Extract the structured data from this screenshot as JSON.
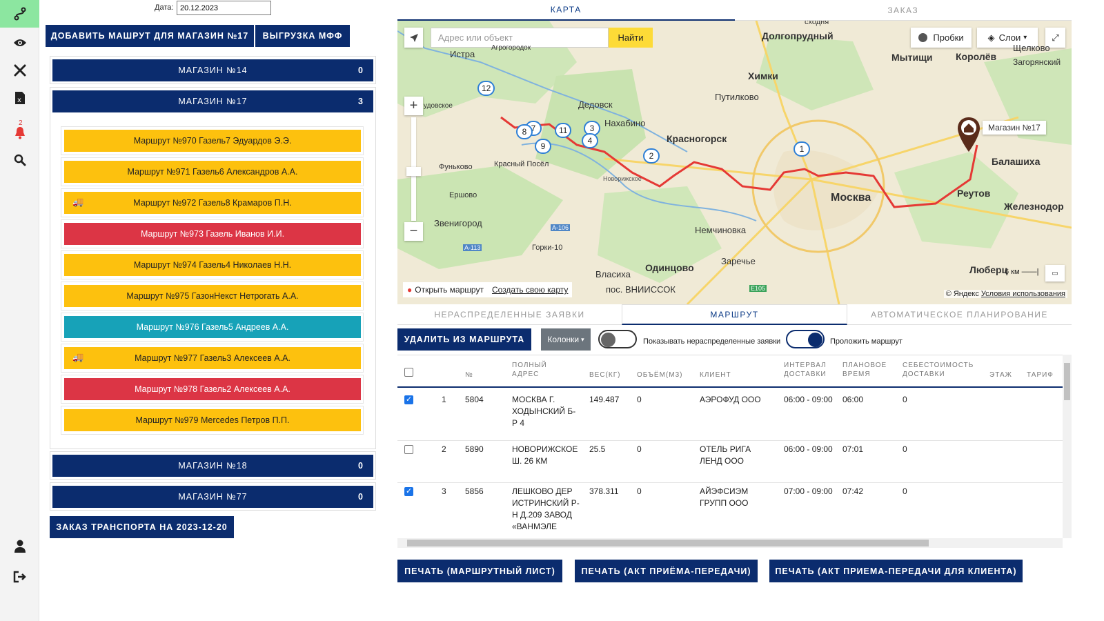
{
  "sidebar": {
    "items": [
      {
        "icon": "route-icon"
      },
      {
        "icon": "eye-icon"
      },
      {
        "icon": "tools-icon"
      },
      {
        "icon": "excel-file-icon"
      },
      {
        "icon": "bell-icon",
        "badge": "2"
      },
      {
        "icon": "search-icon"
      },
      {
        "icon": "user-icon"
      },
      {
        "icon": "logout-icon"
      }
    ]
  },
  "header": {
    "date_label": "Дата:",
    "date_value": "20.12.2023",
    "add_route_label": "ДОБАВИТЬ МАШРУТ ДЛЯ МАГАЗИН №17",
    "export_label": "ВЫГРУЗКА МФФ"
  },
  "stores": [
    {
      "name": "МАГАЗИН №14",
      "count": "0"
    },
    {
      "name": "МАГАЗИН №17",
      "count": "3"
    },
    {
      "name": "МАГАЗИН №18",
      "count": "0"
    },
    {
      "name": "МАГАЗИН №77",
      "count": "0"
    }
  ],
  "routes": [
    {
      "label": "Маршрут №970 Газель7 Эдуардов Э.Э.",
      "color": "yellow",
      "truck": false
    },
    {
      "label": "Маршрут №971 Газель6 Александров А.А.",
      "color": "yellow",
      "truck": false
    },
    {
      "label": "Маршрут №972 Газель8 Крамаров П.Н.",
      "color": "yellow",
      "truck": true
    },
    {
      "label": "Маршрут №973 Газель Иванов И.И.",
      "color": "red",
      "truck": false
    },
    {
      "label": "Маршрут №974 Газель4 Николаев Н.Н.",
      "color": "yellow",
      "truck": false
    },
    {
      "label": "Маршрут №975 ГазонНекст Нетрогать А.А.",
      "color": "yellow",
      "truck": false
    },
    {
      "label": "Маршрут №976 Газель5 Андреев А.А.",
      "color": "teal",
      "truck": false
    },
    {
      "label": "Маршрут №977 Газель3 Алексеев А.А.",
      "color": "yellow",
      "truck": true
    },
    {
      "label": "Маршрут №978 Газель2 Алексеев А.А.",
      "color": "red",
      "truck": false
    },
    {
      "label": "Маршрут №979 Mercedes Петров П.П.",
      "color": "yellow",
      "truck": false
    }
  ],
  "transport_order_label": "ЗАКАЗ ТРАНСПОРТА НА 2023-12-20",
  "top_tabs": [
    {
      "label": "КАРТА",
      "active": true
    },
    {
      "label": "ЗАКАЗ",
      "active": false
    }
  ],
  "map": {
    "search_placeholder": "Адрес или объект",
    "find_label": "Найти",
    "traffic_label": "Пробки",
    "layers_label": "Слои",
    "open_route_label": "Открыть маршрут",
    "create_map_label": "Создать свою карту",
    "copyright": "© Яндекс",
    "terms": "Условия использования",
    "scale": "6 км",
    "store_marker": "Магазин №17",
    "labels": {
      "dolgoprudny": "Долгопрудный",
      "mytishchi": "Мытищи",
      "korolev": "Королёв",
      "shchelkovo": "Щелково",
      "zagoryansky": "Загорянский",
      "istra": "Истра",
      "khimki": "Химки",
      "putilkovo": "Путилково",
      "dedovsk": "Дедовск",
      "nakhabino": "Нахабино",
      "krasnogorsk": "Красногорск",
      "balashikha": "Балашиха",
      "moskva": "Москва",
      "reutov": "Реутов",
      "zheleznodor": "Железнодор",
      "funkovo": "Фуньково",
      "ershovo": "Ершово",
      "zvenigorod": "Звенигород",
      "krasny": "Красный Посёл",
      "nemchinovka": "Немчиновка",
      "zarechye": "Заречье",
      "gorki": "Горки-10",
      "vlasikha": "Власиха",
      "odintsovo": "Одинцово",
      "vniissok": "пос. ВНИИССОК",
      "lyuber": "Люберц",
      "a106": "А-106",
      "a113": "А-113",
      "e105": "E105",
      "ssh": "сходня",
      "agrogorodok": "Агрогородок",
      "udoskoe": "удовское",
      "novaya": "Новорижское"
    },
    "pins": [
      "1",
      "2",
      "3",
      "4",
      "7",
      "8",
      "9",
      "11",
      "12"
    ]
  },
  "mid_tabs": [
    {
      "label": "НЕРАСПРЕДЕЛЕННЫЕ ЗАЯВКИ",
      "active": false
    },
    {
      "label": "МАРШРУТ",
      "active": true
    },
    {
      "label": "АВТОМАТИЧЕСКОЕ ПЛАНИРОВАНИЕ",
      "active": false
    }
  ],
  "toolbar": {
    "delete_label": "УДАЛИТЬ ИЗ МАРШРУТА",
    "columns_label": "Колонки",
    "show_unassigned_label": "Показывать нераспределенные заявки",
    "show_unassigned_on": false,
    "lay_route_label": "Проложить маршрут",
    "lay_route_on": true
  },
  "table": {
    "headers": [
      "№",
      "ПОЛНЫЙ АДРЕС",
      "ВЕС(КГ)",
      "ОБЪЁМ(М3)",
      "КЛИЕНТ",
      "ИНТЕРВАЛ ДОСТАВКИ",
      "ПЛАНОВОЕ ВРЕМЯ",
      "СЕБЕСТОИМОСТЬ ДОСТАВКИ",
      "ЭТАЖ",
      "ТАРИФ"
    ],
    "rows": [
      {
        "checked": true,
        "idx": "1",
        "num": "5804",
        "address": "МОСКВА Г. ХОДЫНСКИЙ Б-Р 4",
        "weight": "149.487",
        "volume": "0",
        "client": "АЭРОФУД ООО",
        "interval": "06:00 - 09:00",
        "time": "06:00",
        "cost": "0"
      },
      {
        "checked": false,
        "idx": "2",
        "num": "5890",
        "address": "НОВОРИЖСКОЕ Ш. 26 КМ",
        "weight": "25.5",
        "volume": "0",
        "client": "ОТЕЛЬ РИГА ЛЕНД ООО",
        "interval": "06:00 - 09:00",
        "time": "07:01",
        "cost": "0"
      },
      {
        "checked": true,
        "idx": "3",
        "num": "5856",
        "address": "ЛЕШКОВО ДЕР ИСТРИНСКИЙ Р-Н Д.209 ЗАВОД «ВАНМЭЛЕ",
        "weight": "378.311",
        "volume": "0",
        "client": "АЙЭФСИЭМ ГРУПП ООО",
        "interval": "07:00 - 09:00",
        "time": "07:42",
        "cost": "0"
      }
    ]
  },
  "print_buttons": [
    "ПЕЧАТЬ (МАРШРУТНЫЙ ЛИСТ)",
    "ПЕЧАТЬ (АКТ ПРИЁМА-ПЕРЕДАЧИ)",
    "ПЕЧАТЬ (АКТ ПРИЕМА-ПЕРЕДАЧИ ДЛЯ КЛИЕНТА)"
  ],
  "colors": {
    "navy": "#0b2c6e",
    "yellow": "#fdc10e",
    "red": "#dc3545",
    "teal": "#17a2b8",
    "route_line": "#e53935",
    "active_nav": "#8ce6a0"
  }
}
